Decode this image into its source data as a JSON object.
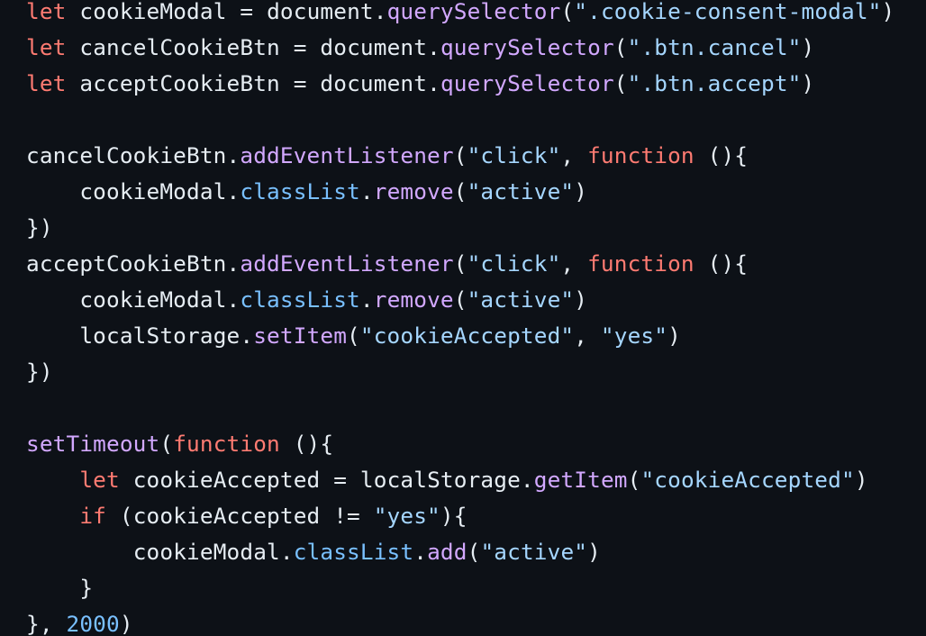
{
  "theme": {
    "background": "#0d1117",
    "default_text": "#e6edf3",
    "keyword": "#ff7b72",
    "function": "#d2a8ff",
    "string": "#a5d6ff",
    "property": "#79c0ff",
    "number": "#79c0ff"
  },
  "code": {
    "lines": [
      [
        [
          "kw",
          "let"
        ],
        [
          "pn",
          " "
        ],
        [
          "id",
          "cookieModal"
        ],
        [
          "pn",
          " = "
        ],
        [
          "id",
          "document"
        ],
        [
          "pn",
          "."
        ],
        [
          "fn",
          "querySelector"
        ],
        [
          "pn",
          "("
        ],
        [
          "str",
          "\".cookie-consent-modal\""
        ],
        [
          "pn",
          ")"
        ]
      ],
      [
        [
          "kw",
          "let"
        ],
        [
          "pn",
          " "
        ],
        [
          "id",
          "cancelCookieBtn"
        ],
        [
          "pn",
          " = "
        ],
        [
          "id",
          "document"
        ],
        [
          "pn",
          "."
        ],
        [
          "fn",
          "querySelector"
        ],
        [
          "pn",
          "("
        ],
        [
          "str",
          "\".btn.cancel\""
        ],
        [
          "pn",
          ")"
        ]
      ],
      [
        [
          "kw",
          "let"
        ],
        [
          "pn",
          " "
        ],
        [
          "id",
          "acceptCookieBtn"
        ],
        [
          "pn",
          " = "
        ],
        [
          "id",
          "document"
        ],
        [
          "pn",
          "."
        ],
        [
          "fn",
          "querySelector"
        ],
        [
          "pn",
          "("
        ],
        [
          "str",
          "\".btn.accept\""
        ],
        [
          "pn",
          ")"
        ]
      ],
      [],
      [
        [
          "id",
          "cancelCookieBtn"
        ],
        [
          "pn",
          "."
        ],
        [
          "fn",
          "addEventListener"
        ],
        [
          "pn",
          "("
        ],
        [
          "str",
          "\"click\""
        ],
        [
          "pn",
          ", "
        ],
        [
          "kw",
          "function"
        ],
        [
          "pn",
          " (){"
        ]
      ],
      [
        [
          "pn",
          "    "
        ],
        [
          "id",
          "cookieModal"
        ],
        [
          "pn",
          "."
        ],
        [
          "prop",
          "classList"
        ],
        [
          "pn",
          "."
        ],
        [
          "fn",
          "remove"
        ],
        [
          "pn",
          "("
        ],
        [
          "str",
          "\"active\""
        ],
        [
          "pn",
          ")"
        ]
      ],
      [
        [
          "pn",
          "})"
        ]
      ],
      [
        [
          "id",
          "acceptCookieBtn"
        ],
        [
          "pn",
          "."
        ],
        [
          "fn",
          "addEventListener"
        ],
        [
          "pn",
          "("
        ],
        [
          "str",
          "\"click\""
        ],
        [
          "pn",
          ", "
        ],
        [
          "kw",
          "function"
        ],
        [
          "pn",
          " (){"
        ]
      ],
      [
        [
          "pn",
          "    "
        ],
        [
          "id",
          "cookieModal"
        ],
        [
          "pn",
          "."
        ],
        [
          "prop",
          "classList"
        ],
        [
          "pn",
          "."
        ],
        [
          "fn",
          "remove"
        ],
        [
          "pn",
          "("
        ],
        [
          "str",
          "\"active\""
        ],
        [
          "pn",
          ")"
        ]
      ],
      [
        [
          "pn",
          "    "
        ],
        [
          "id",
          "localStorage"
        ],
        [
          "pn",
          "."
        ],
        [
          "fn",
          "setItem"
        ],
        [
          "pn",
          "("
        ],
        [
          "str",
          "\"cookieAccepted\""
        ],
        [
          "pn",
          ", "
        ],
        [
          "str",
          "\"yes\""
        ],
        [
          "pn",
          ")"
        ]
      ],
      [
        [
          "pn",
          "})"
        ]
      ],
      [],
      [
        [
          "fn",
          "setTimeout"
        ],
        [
          "pn",
          "("
        ],
        [
          "kw",
          "function"
        ],
        [
          "pn",
          " (){"
        ]
      ],
      [
        [
          "pn",
          "    "
        ],
        [
          "kw",
          "let"
        ],
        [
          "pn",
          " "
        ],
        [
          "id",
          "cookieAccepted"
        ],
        [
          "pn",
          " = "
        ],
        [
          "id",
          "localStorage"
        ],
        [
          "pn",
          "."
        ],
        [
          "fn",
          "getItem"
        ],
        [
          "pn",
          "("
        ],
        [
          "str",
          "\"cookieAccepted\""
        ],
        [
          "pn",
          ")"
        ]
      ],
      [
        [
          "pn",
          "    "
        ],
        [
          "kw",
          "if"
        ],
        [
          "pn",
          " ("
        ],
        [
          "id",
          "cookieAccepted"
        ],
        [
          "pn",
          " != "
        ],
        [
          "str",
          "\"yes\""
        ],
        [
          "pn",
          "){"
        ]
      ],
      [
        [
          "pn",
          "        "
        ],
        [
          "id",
          "cookieModal"
        ],
        [
          "pn",
          "."
        ],
        [
          "prop",
          "classList"
        ],
        [
          "pn",
          "."
        ],
        [
          "fn",
          "add"
        ],
        [
          "pn",
          "("
        ],
        [
          "str",
          "\"active\""
        ],
        [
          "pn",
          ")"
        ]
      ],
      [
        [
          "pn",
          "    }"
        ]
      ],
      [
        [
          "pn",
          "}, "
        ],
        [
          "num",
          "2000"
        ],
        [
          "pn",
          ")"
        ]
      ]
    ]
  }
}
